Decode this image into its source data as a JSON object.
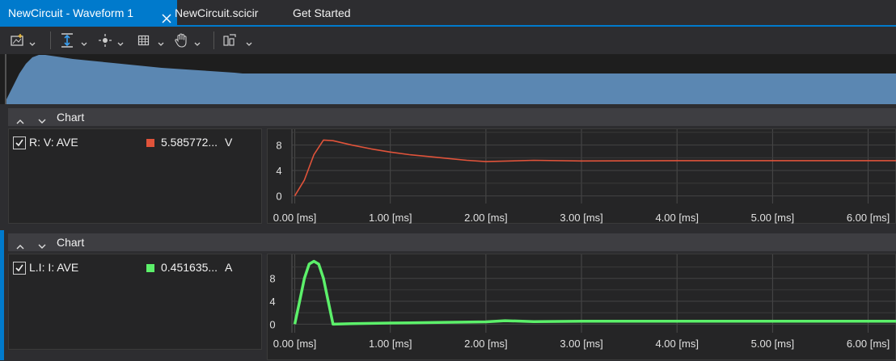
{
  "tabs": [
    {
      "label": "NewCircuit - Waveform 1",
      "active": true
    },
    {
      "label": "NewCircuit.scicir",
      "active": false
    },
    {
      "label": "Get Started",
      "active": false
    }
  ],
  "toolbar": {
    "icons": [
      "add-chart-icon",
      "fit-vertical-icon",
      "cursor-icon",
      "grid-icon",
      "pan-hand-icon",
      "layout-icon"
    ]
  },
  "charts": [
    {
      "header": "Chart",
      "signal": {
        "name": "R: V: AVE",
        "value": "5.585772...",
        "unit": "V",
        "color": "#e0533a",
        "checked": true
      }
    },
    {
      "header": "Chart",
      "signal": {
        "name": "L.I: I: AVE",
        "value": "0.451635...",
        "unit": "A",
        "color": "#5cf06a",
        "checked": true
      }
    }
  ],
  "chart_data": [
    {
      "type": "line",
      "series": [
        {
          "x": [
            0,
            0.1,
            0.2,
            0.3,
            0.4,
            0.6,
            0.8,
            1.0,
            1.2,
            1.4,
            1.6,
            1.8,
            2.0,
            2.5,
            3.0,
            4.0,
            5.0,
            6.0,
            6.3
          ],
          "y": [
            0,
            2.5,
            6.5,
            8.8,
            8.7,
            8.0,
            7.4,
            6.9,
            6.5,
            6.2,
            5.9,
            5.6,
            5.4,
            5.6,
            5.5,
            5.55,
            5.55,
            5.55,
            5.55
          ]
        }
      ],
      "xticks": [
        "0.00 [ms]",
        "1.00 [ms]",
        "2.00 [ms]",
        "3.00 [ms]",
        "4.00 [ms]",
        "5.00 [ms]",
        "6.00 [ms]"
      ],
      "yticks": [
        "0",
        "4",
        "8"
      ],
      "xlim": [
        -0.03,
        6.3
      ],
      "ylim": [
        -1.2,
        10.5
      ],
      "grid": true
    },
    {
      "type": "line",
      "series": [
        {
          "x": [
            0,
            0.05,
            0.1,
            0.15,
            0.2,
            0.25,
            0.3,
            0.35,
            0.4,
            0.6,
            1.0,
            1.5,
            2.0,
            2.2,
            2.5,
            3.0,
            4.0,
            5.0,
            6.0,
            6.3
          ],
          "y": [
            0,
            4,
            8,
            10.5,
            11.0,
            10.5,
            8,
            4,
            0,
            0.1,
            0.2,
            0.3,
            0.4,
            0.6,
            0.45,
            0.5,
            0.5,
            0.5,
            0.5,
            0.5
          ]
        }
      ],
      "xticks": [
        "0.00 [ms]",
        "1.00 [ms]",
        "2.00 [ms]",
        "3.00 [ms]",
        "4.00 [ms]",
        "5.00 [ms]",
        "6.00 [ms]"
      ],
      "yticks": [
        "0",
        "4",
        "8"
      ],
      "xlim": [
        -0.03,
        6.3
      ],
      "ylim": [
        -1.5,
        12.2
      ],
      "grid": true
    }
  ]
}
